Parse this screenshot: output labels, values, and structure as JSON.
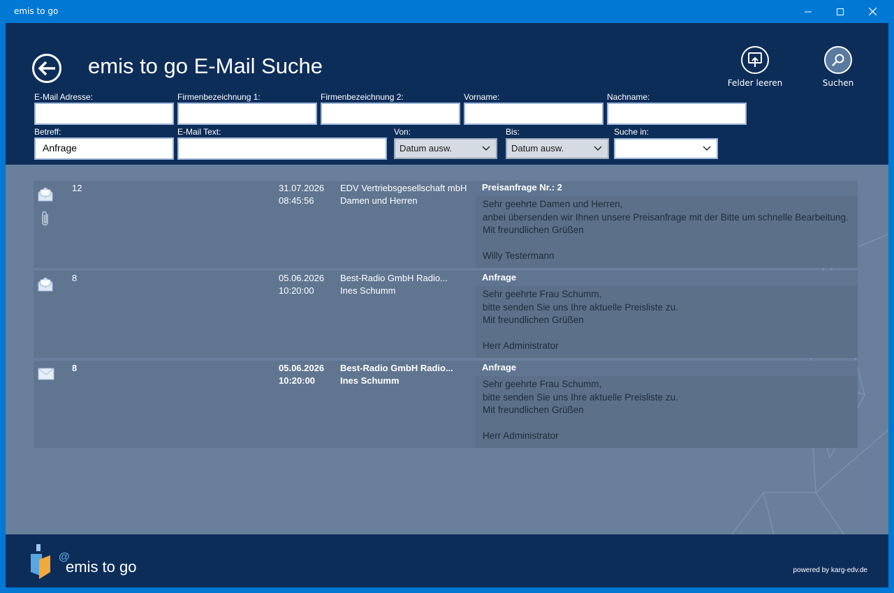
{
  "window": {
    "title": "emis to go",
    "minimize_icon": "minimize-icon",
    "maximize_icon": "maximize-icon",
    "close_icon": "close-icon"
  },
  "header": {
    "title": "emis to go E-Mail Suche",
    "back_icon": "arrow-left-icon",
    "clear_label": "Felder leeren",
    "search_label": "Suchen"
  },
  "form": {
    "email_label": "E-Mail Adresse:",
    "email_value": "",
    "firm1_label": "Firmenbezeichnung 1:",
    "firm1_value": "",
    "firm2_label": "Firmenbezeichnung 2:",
    "firm2_value": "",
    "firstname_label": "Vorname:",
    "firstname_value": "",
    "lastname_label": "Nachname:",
    "lastname_value": "",
    "subject_label": "Betreff:",
    "subject_value": "Anfrage",
    "text_label": "E-Mail Text:",
    "text_value": "",
    "from_label": "Von:",
    "from_value": "Datum ausw.",
    "to_label": "Bis:",
    "to_value": "Datum ausw.",
    "searchin_label": "Suche in:",
    "searchin_value": ""
  },
  "results": [
    {
      "count": "12",
      "date": "31.07.2026",
      "time": "08:45:56",
      "company": "EDV Vertriebsgesellschaft mbH",
      "contact": "Damen und Herren",
      "subject": "Preisanfrage Nr.: 2",
      "body": [
        "Sehr geehrte Damen und Herren,",
        "anbei übersenden wir Ihnen unsere Preisanfrage mit der Bitte um schnelle Bearbeitung.",
        "Mit freundlichen Grüßen",
        "",
        "Willy Testermann"
      ],
      "icon": "envelope-open-icon",
      "attachment_icon": "paperclip-icon"
    },
    {
      "count": "8",
      "date": "05.06.2026",
      "time": "10:20:00",
      "company": "Best-Radio GmbH Radio...",
      "contact": "Ines Schumm",
      "subject": "Anfrage",
      "body": [
        "Sehr geehrte Frau Schumm,",
        "bitte senden Sie uns Ihre aktuelle Preisliste zu.",
        "Mit freundlichen Grüßen",
        "",
        "Herr Administrator"
      ],
      "icon": "envelope-open-icon"
    },
    {
      "count": "8",
      "date": "05.06.2026",
      "time": "10:20:00",
      "company": "Best-Radio GmbH Radio...",
      "contact": "Ines Schumm",
      "subject": "Anfrage",
      "body": [
        "Sehr geehrte Frau Schumm,",
        "bitte senden Sie uns Ihre aktuelle Preisliste zu.",
        "Mit freundlichen Grüßen",
        "",
        "Herr Administrator"
      ],
      "icon": "envelope-closed-icon"
    }
  ],
  "footer": {
    "brand": "emis to go",
    "at": "@",
    "powered": "powered by karg-edv.de"
  },
  "colors": {
    "titlebar": "#0078d4",
    "header_bg": "#0d2d59",
    "content_bg": "#697f9c",
    "row_bg": "#5f7590"
  }
}
